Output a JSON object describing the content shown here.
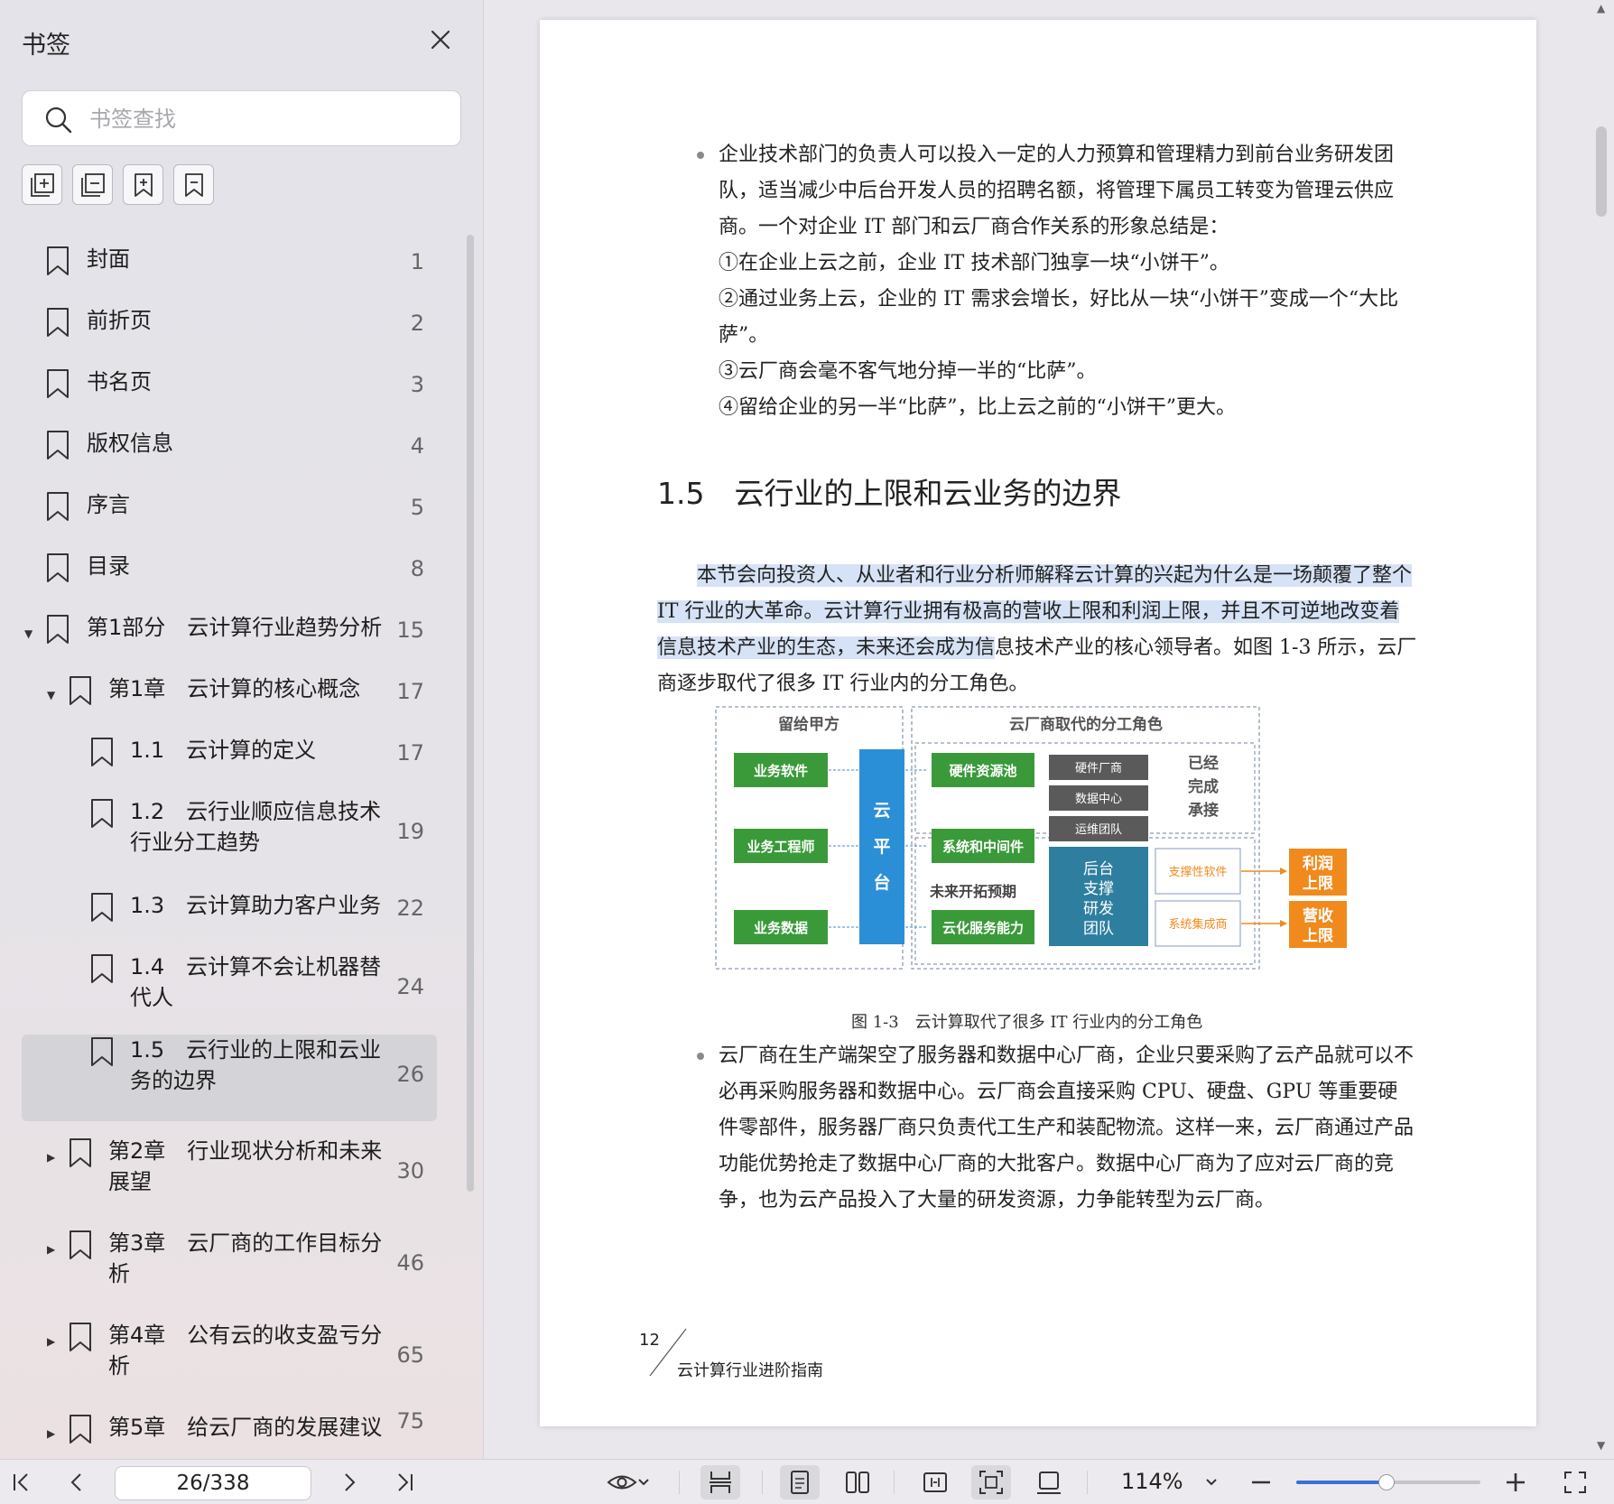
{
  "sidebar": {
    "title": "书签",
    "search_placeholder": "书签查找",
    "bookmarks": [
      {
        "label": "封面",
        "page": "1"
      },
      {
        "label": "前折页",
        "page": "2"
      },
      {
        "label": "书名页",
        "page": "3"
      },
      {
        "label": "版权信息",
        "page": "4"
      },
      {
        "label": "序言",
        "page": "5"
      },
      {
        "label": "目录",
        "page": "8"
      },
      {
        "label": "第1部分　云计算行业趋势分析",
        "page": "15"
      },
      {
        "label": "第1章　云计算的核心概念",
        "page": "17"
      },
      {
        "label": "1.1　云计算的定义",
        "page": "17"
      },
      {
        "label": "1.2　云行业顺应信息技术行业分工趋势",
        "page": "19"
      },
      {
        "label": "1.3　云计算助力客户业务",
        "page": "22"
      },
      {
        "label": "1.4　云计算不会让机器替代人",
        "page": "24"
      },
      {
        "label": "1.5　云行业的上限和云业务的边界",
        "page": "26"
      },
      {
        "label": "第2章　行业现状分析和未来展望",
        "page": "30"
      },
      {
        "label": "第3章　云厂商的工作目标分析",
        "page": "46"
      },
      {
        "label": "第4章　公有云的收支盈亏分析",
        "page": "65"
      },
      {
        "label": "第5章　给云厂商的发展建议",
        "page": "75"
      }
    ]
  },
  "document": {
    "bullet1": "企业技术部门的负责人可以投入一定的人力预算和管理精力到前台业务研发团队，适当减少中后台开发人员的招聘名额，将管理下属员工转变为管理云供应商。一个对企业 IT 部门和云厂商合作关系的形象总结是：",
    "bullet1_items": [
      "①在企业上云之前，企业 IT 技术部门独享一块“小饼干”。",
      "②通过业务上云，企业的 IT 需求会增长，好比从一块“小饼干”变成一个“大比萨”。",
      "③云厂商会毫不客气地分掉一半的“比萨”。",
      "④留给企业的另一半“比萨”，比上云之前的“小饼干”更大。"
    ],
    "section_heading": "1.5　云行业的上限和云业务的边界",
    "para_highlight": "本节会向投资人、从业者和行业分析师解释云计算的兴起为什么是一场颠覆了整个 IT 行业的大革命。云计算行业拥有极高的营收上限和利润上限，并且不可逆地改变着信息技术产业的生态，未来还会成为信",
    "para_rest": "息技术产业的核心领导者。如图 1-3 所示，云厂商逐步取代了很多 IT 行业内的分工角色。",
    "figure": {
      "left_title": "留给甲方",
      "right_title": "云厂商取代的分工角色",
      "left_boxes": [
        "业务软件",
        "业务工程师",
        "业务数据"
      ],
      "platform": [
        "云",
        "平",
        "台"
      ],
      "mid_boxes": [
        "硬件资源池",
        "系统和中间件",
        "云化服务能力"
      ],
      "future_label": "未来开拓预期",
      "gray_boxes": [
        "硬件厂商",
        "数据中心",
        "运维团队"
      ],
      "done_label": [
        "已经",
        "完成",
        "承接"
      ],
      "backend_team": [
        "后台",
        "支撑",
        "研发",
        "团队"
      ],
      "support_boxes": [
        "支撑性软件",
        "系统集成商"
      ],
      "limit_boxes": [
        [
          "利润",
          "上限"
        ],
        [
          "营收",
          "上限"
        ]
      ]
    },
    "figure_caption": "图 1-3　云计算取代了很多 IT 行业内的分工角色",
    "bullet2": "云厂商在生产端架空了服务器和数据中心厂商，企业只要采购了云产品就可以不必再采购服务器和数据中心。云厂商会直接采购 CPU、硬盘、GPU 等重要硬件零部件，服务器厂商只负责代工生产和装配物流。这样一来，云厂商通过产品功能优势抢走了数据中心厂商的大批客户。数据中心厂商为了应对云厂商的竞争，也为云产品投入了大量的研发资源，力争能转型为云厂商。",
    "footer_page": "12",
    "footer_title": "云计算行业进阶指南"
  },
  "toolbar": {
    "page_indicator": "26/338",
    "zoom": "114%",
    "zoom_level": 0.49
  },
  "colors": {
    "green": "#3a9a3a",
    "blue_platform": "#2b8fd8",
    "teal_team": "#2e7f9f",
    "orange": "#f08a1c",
    "highlight": "#d6e2f5",
    "accent": "#3a6fd8"
  }
}
